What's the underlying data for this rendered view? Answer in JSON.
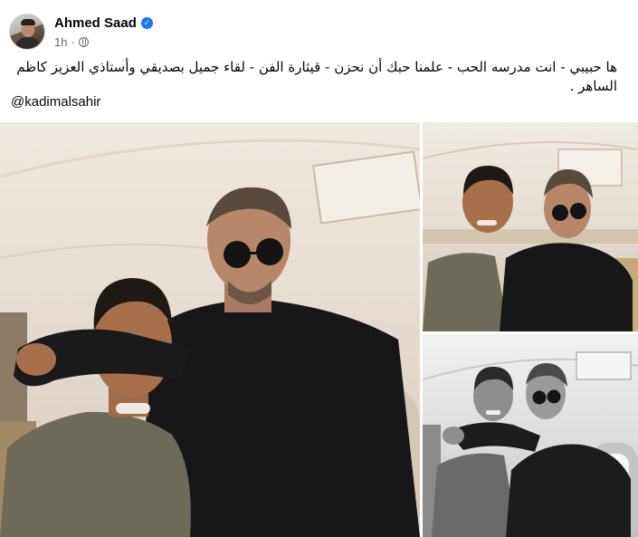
{
  "post": {
    "author_name": "Ahmed Saad",
    "timestamp": "1h",
    "separator": "·",
    "verified_symbol": "✓",
    "text": "ها حبيبي - انت مدرسه الحب - علمنا حبك أن نحزن - قيثارة الفن - لقاء جميل بصديقي وأستاذي العزيز كاظم الساهر .",
    "mention": "@kadimalsahir"
  },
  "icons": {
    "verified": "verified-badge-icon",
    "audience": "globe-icon"
  },
  "colors": {
    "link_blue": "#1877f2",
    "meta_gray": "#65676b",
    "text": "#050505"
  },
  "photos": [
    {
      "name": "photo-main",
      "tone": "color"
    },
    {
      "name": "photo-top-right",
      "tone": "color"
    },
    {
      "name": "photo-bottom-right",
      "tone": "grayscale"
    }
  ]
}
